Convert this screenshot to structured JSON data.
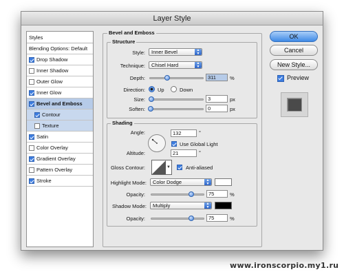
{
  "window": {
    "title": "Layer Style"
  },
  "styles_list": {
    "header": "Styles",
    "items": [
      {
        "label": "Blending Options: Default",
        "checkbox": false,
        "checked": false,
        "selected": false,
        "sub": false
      },
      {
        "label": "Drop Shadow",
        "checkbox": true,
        "checked": true,
        "selected": false,
        "sub": false
      },
      {
        "label": "Inner Shadow",
        "checkbox": true,
        "checked": false,
        "selected": false,
        "sub": false
      },
      {
        "label": "Outer Glow",
        "checkbox": true,
        "checked": false,
        "selected": false,
        "sub": false
      },
      {
        "label": "Inner Glow",
        "checkbox": true,
        "checked": true,
        "selected": false,
        "sub": false
      },
      {
        "label": "Bevel and Emboss",
        "checkbox": true,
        "checked": true,
        "selected": true,
        "sub": false
      },
      {
        "label": "Contour",
        "checkbox": true,
        "checked": true,
        "selected": false,
        "sub": true
      },
      {
        "label": "Texture",
        "checkbox": true,
        "checked": false,
        "selected": false,
        "sub": true
      },
      {
        "label": "Satin",
        "checkbox": true,
        "checked": true,
        "selected": false,
        "sub": false
      },
      {
        "label": "Color Overlay",
        "checkbox": true,
        "checked": false,
        "selected": false,
        "sub": false
      },
      {
        "label": "Gradient Overlay",
        "checkbox": true,
        "checked": true,
        "selected": false,
        "sub": false
      },
      {
        "label": "Pattern Overlay",
        "checkbox": true,
        "checked": false,
        "selected": false,
        "sub": false
      },
      {
        "label": "Stroke",
        "checkbox": true,
        "checked": true,
        "selected": false,
        "sub": false
      }
    ]
  },
  "bevel": {
    "title": "Bevel and Emboss",
    "structure": {
      "title": "Structure",
      "style_label": "Style:",
      "style_value": "Inner Bevel",
      "technique_label": "Technique:",
      "technique_value": "Chisel Hard",
      "depth_label": "Depth:",
      "depth_value": "311",
      "depth_unit": "%",
      "direction_label": "Direction:",
      "direction_up": "Up",
      "direction_down": "Down",
      "direction_selected": "Up",
      "size_label": "Size:",
      "size_value": "3",
      "size_unit": "px",
      "soften_label": "Soften:",
      "soften_value": "0",
      "soften_unit": "px"
    },
    "shading": {
      "title": "Shading",
      "angle_label": "Angle:",
      "angle_value": "132",
      "angle_unit": "°",
      "use_global_light": "Use Global Light",
      "use_global_light_checked": true,
      "altitude_label": "Altitude:",
      "altitude_value": "21",
      "altitude_unit": "°",
      "gloss_contour_label": "Gloss Contour:",
      "anti_aliased": "Anti-aliased",
      "anti_aliased_checked": true,
      "highlight_mode_label": "Highlight Mode:",
      "highlight_mode_value": "Color Dodge",
      "highlight_color": "#ffffff",
      "highlight_opacity_label": "Opacity:",
      "highlight_opacity_value": "75",
      "highlight_opacity_unit": "%",
      "shadow_mode_label": "Shadow Mode:",
      "shadow_mode_value": "Multiply",
      "shadow_color": "#000000",
      "shadow_opacity_label": "Opacity:",
      "shadow_opacity_value": "75",
      "shadow_opacity_unit": "%"
    }
  },
  "buttons": {
    "ok": "OK",
    "cancel": "Cancel",
    "new_style": "New Style...",
    "preview": "Preview",
    "preview_checked": true
  },
  "watermark": "www.ironscorpio.my1.ru"
}
